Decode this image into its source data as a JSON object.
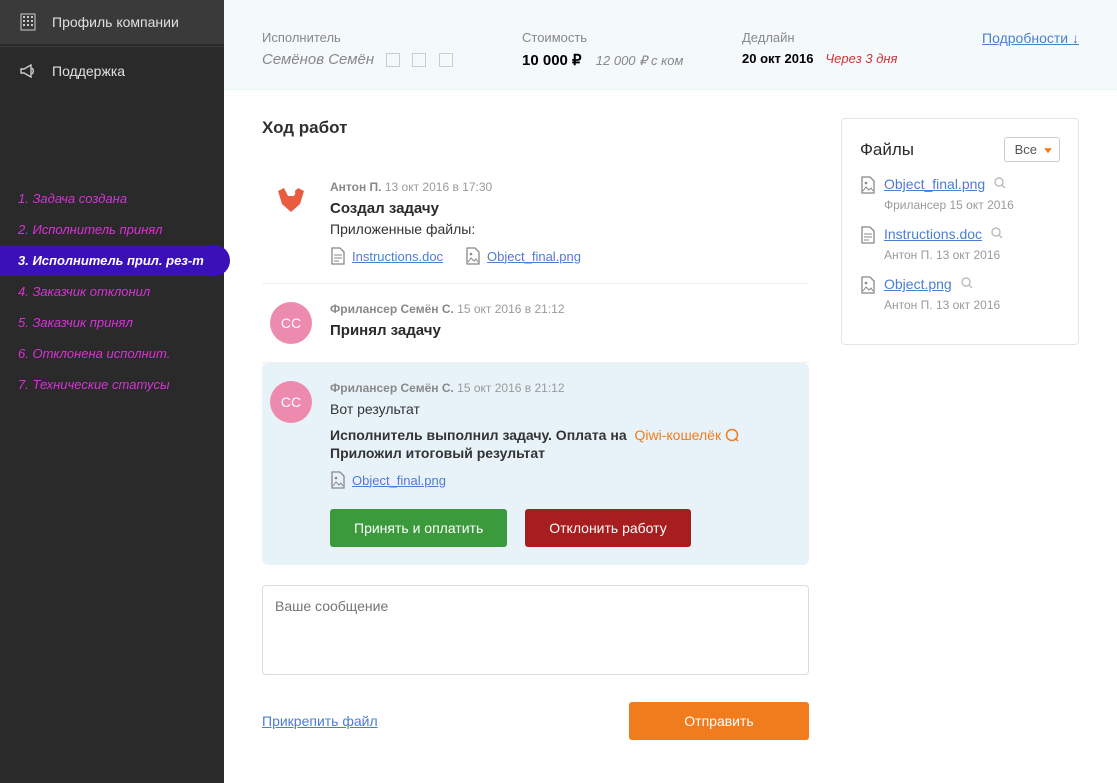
{
  "sidebar": {
    "nav": [
      {
        "label": "Профиль компании",
        "icon": "building-icon"
      },
      {
        "label": "Поддержка",
        "icon": "megaphone-icon"
      }
    ],
    "steps": [
      "1. Задача создана",
      "2. Исполнитель принял",
      "3. Исполнитель прил. рез-т",
      "4. Заказчик отклонил",
      "5. Заказчик принял",
      "6. Отклонена исполнит.",
      "7. Технические статусы"
    ],
    "active_step": 2
  },
  "header": {
    "executor": {
      "label": "Исполнитель",
      "value": "Семёнов Семён"
    },
    "cost": {
      "label": "Стоимость",
      "value": "10 000 ₽",
      "note": "12 000 ₽ с ком"
    },
    "deadline": {
      "label": "Дедлайн",
      "value": "20 окт 2016",
      "note": "Через 3 дня"
    },
    "details_link": "Подробности ↓"
  },
  "section_title": "Ход работ",
  "feed": [
    {
      "avatar": "fox",
      "author": "Антон П.",
      "time": "13 окт 2016 в 17:30",
      "title": "Создал задачу",
      "subtitle": "Приложенные файлы:",
      "attachments": [
        {
          "icon": "doc",
          "name": "Instructions.doc"
        },
        {
          "icon": "img",
          "name": "Object_final.png"
        }
      ]
    },
    {
      "avatar": "cc",
      "initials": "СС",
      "author": "Фрилансер Семён С.",
      "time": "15 окт 2016 в 21:12",
      "title": "Принял задачу"
    },
    {
      "highlight": true,
      "avatar": "cc",
      "initials": "СС",
      "author": "Фрилансер Семён С.",
      "time": "15 окт 2016 в 21:12",
      "text": "Вот результат",
      "payment_line": "Исполнитель выполнил задачу. Оплата на",
      "payment_method": "Qiwi-кошелёк",
      "result_line": "Приложил итоговый результат",
      "attachments": [
        {
          "icon": "img",
          "name": "Object_final.png"
        }
      ],
      "actions": {
        "accept": "Принять и оплатить",
        "reject": "Отклонить работу"
      }
    }
  ],
  "composer": {
    "placeholder": "Ваше сообщение",
    "attach_link": "Прикрепить файл",
    "send_btn": "Отправить"
  },
  "aside": {
    "title": "Файлы",
    "filter": "Все",
    "files": [
      {
        "name": "Object_final.png",
        "meta_author": "Фрилансер",
        "meta_date": "15 окт 2016"
      },
      {
        "name": "Instructions.doc",
        "meta_author": "Антон П.",
        "meta_date": "13 окт 2016"
      },
      {
        "name": "Object.png",
        "meta_author": "Антон П.",
        "meta_date": "13 окт 2016"
      }
    ]
  }
}
